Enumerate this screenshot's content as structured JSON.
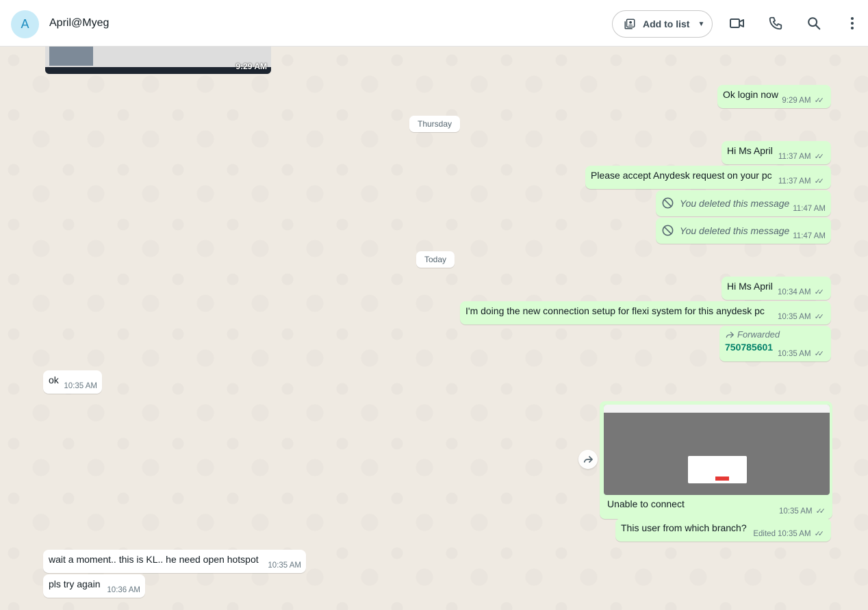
{
  "header": {
    "avatar_letter": "A",
    "contact_name": "April@Myeg",
    "add_to_list": "Add to list",
    "icons": [
      "contacts-icon",
      "video-call-icon",
      "phone-icon",
      "search-icon",
      "more-vert-icon"
    ]
  },
  "image1": {
    "time": "9:29 AM"
  },
  "messages": {
    "m1": {
      "text": "Ok login now",
      "time": "9:29 AM"
    },
    "date1": "Thursday",
    "m2": {
      "text": "Hi Ms April",
      "time": "11:37 AM"
    },
    "m3": {
      "text": "Please accept Anydesk request on your pc",
      "time": "11:37 AM"
    },
    "m4": {
      "text": "You deleted this message",
      "time": "11:47 AM"
    },
    "m5": {
      "text": "You deleted this message",
      "time": "11:47 AM"
    },
    "date2": "Today",
    "m6": {
      "text": "Hi Ms April",
      "time": "10:34 AM"
    },
    "m7": {
      "text": "I'm doing the new connection setup for flexi system for this anydesk pc",
      "time": "10:35 AM"
    },
    "m8": {
      "forwarded": "Forwarded",
      "text": "750785601",
      "time": "10:35 AM"
    },
    "m9": {
      "text": "ok",
      "time": "10:35 AM"
    },
    "m10": {
      "caption": "Unable to connect",
      "time": "10:35 AM"
    },
    "m11": {
      "text": "This user from which branch?",
      "edited": "Edited",
      "time": "10:35 AM"
    },
    "m12": {
      "text": "wait a moment.. this is KL.. he need open hotspot",
      "time": "10:35 AM"
    },
    "m13": {
      "text": "pls try again",
      "time": "10:36 AM"
    }
  },
  "colors": {
    "outgoing": "#d9fdd3",
    "incoming": "#ffffff",
    "background": "#efeae2",
    "accent": "#008069"
  }
}
